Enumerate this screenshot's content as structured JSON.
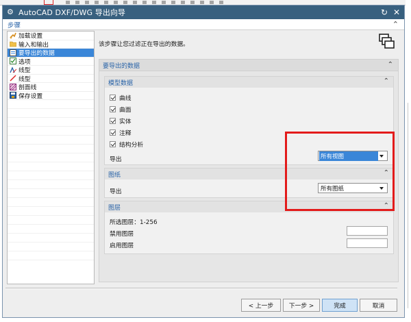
{
  "window": {
    "title": "AutoCAD DXF/DWG 导出向导",
    "restore_glyph": "↻",
    "close_glyph": "✕"
  },
  "steps": {
    "header": "步骤",
    "items": [
      {
        "label": "加载设置",
        "icon": "load-settings-icon",
        "active": false
      },
      {
        "label": "输入和输出",
        "icon": "folder-icon",
        "active": false
      },
      {
        "label": "要导出的数据",
        "icon": "data-icon",
        "active": true
      },
      {
        "label": "选项",
        "icon": "options-icon",
        "active": false
      },
      {
        "label": "线型",
        "icon": "linetype-icon",
        "active": false
      },
      {
        "label": "线型",
        "icon": "line-icon",
        "active": false
      },
      {
        "label": "剖面线",
        "icon": "hatch-icon",
        "active": false
      },
      {
        "label": "保存设置",
        "icon": "save-settings-icon",
        "active": false
      }
    ]
  },
  "main": {
    "intro": "该步骤让您过滤正在导出的数据。",
    "section_title": "要导出的数据",
    "model_data": {
      "title": "模型数据",
      "checkboxes": [
        {
          "label": "曲线",
          "checked": true
        },
        {
          "label": "曲面",
          "checked": true
        },
        {
          "label": "实体",
          "checked": true
        },
        {
          "label": "注释",
          "checked": true
        },
        {
          "label": "结构分析",
          "checked": true
        }
      ],
      "export_label": "导出",
      "export_value": "所有视图"
    },
    "drawings": {
      "title": "图纸",
      "export_label": "导出",
      "export_value": "所有图纸"
    },
    "layers": {
      "title": "图层",
      "selected_label": "所选图层：1-256",
      "disabled_label": "禁用图层",
      "enabled_label": "启用图层"
    }
  },
  "footer": {
    "back": "< 上一步",
    "next": "下一步 >",
    "finish": "完成",
    "cancel": "取消"
  },
  "colors": {
    "titlebar": "#38607f",
    "accent": "#2a64a8",
    "selection": "#3a86d8",
    "highlight_box": "#e31b1b"
  }
}
